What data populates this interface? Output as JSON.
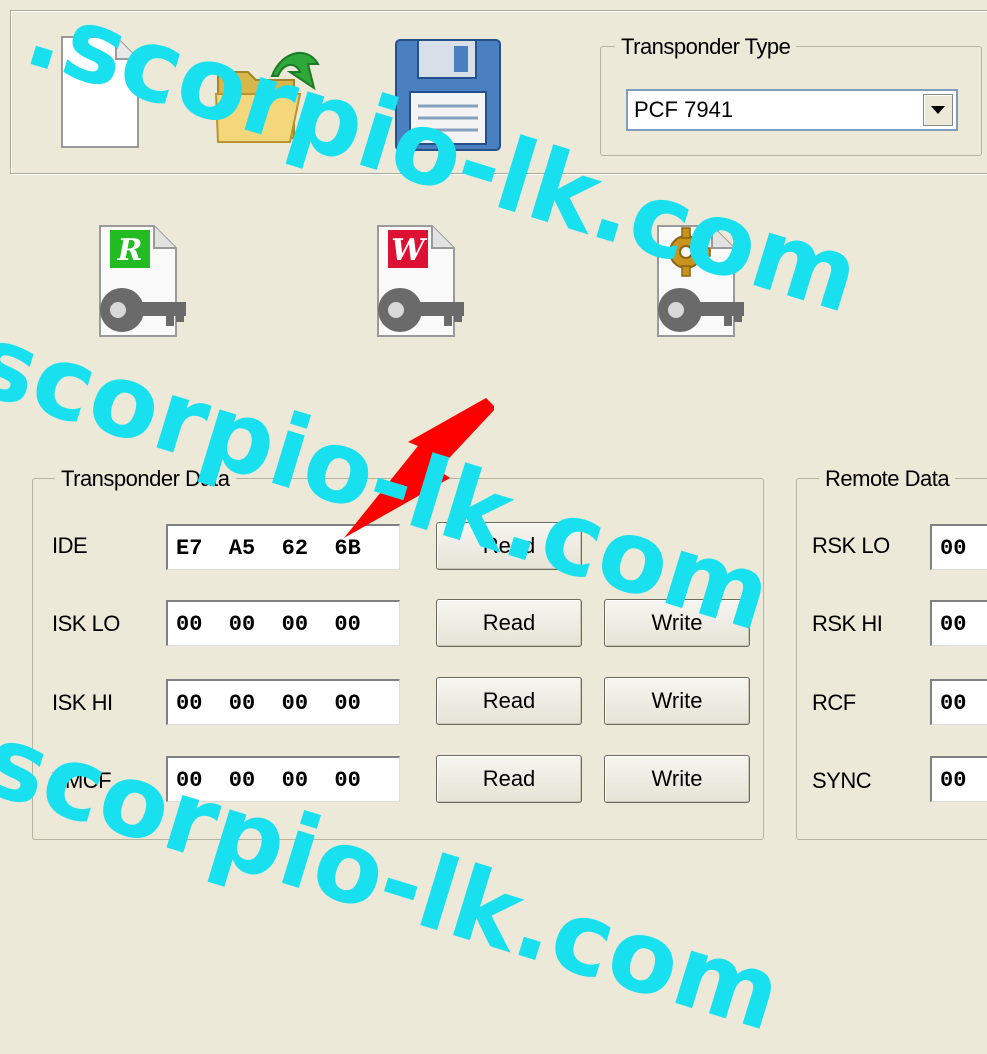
{
  "toolbar": {
    "transponder_type": {
      "legend": "Transponder Type",
      "selected": "PCF 7941"
    }
  },
  "actions": {
    "read_key_letter": "R",
    "write_key_letter": "W"
  },
  "transponder_data": {
    "legend": "Transponder Data",
    "rows": [
      {
        "label": "IDE",
        "value": "E7  A5  62  6B",
        "read": "Read"
      },
      {
        "label": "ISK LO",
        "value": "00  00  00  00",
        "read": "Read",
        "write": "Write"
      },
      {
        "label": "ISK HI",
        "value": "00  00  00  00",
        "read": "Read",
        "write": "Write"
      },
      {
        "label": "TMCF",
        "value": "00  00  00  00",
        "read": "Read",
        "write": "Write"
      }
    ]
  },
  "remote_data": {
    "legend": "Remote Data",
    "rows": [
      {
        "label": "RSK LO",
        "value": "00"
      },
      {
        "label": "RSK HI",
        "value": "00"
      },
      {
        "label": "RCF",
        "value": "00"
      },
      {
        "label": "SYNC",
        "value": "00"
      }
    ]
  },
  "watermark": {
    "text": ".scorpio-lk.com",
    "color": "#19e0ef"
  },
  "colors": {
    "background": "#ece9d8",
    "arrow": "#ff0000",
    "read_badge": "#22bb22",
    "write_badge": "#dd1133"
  }
}
